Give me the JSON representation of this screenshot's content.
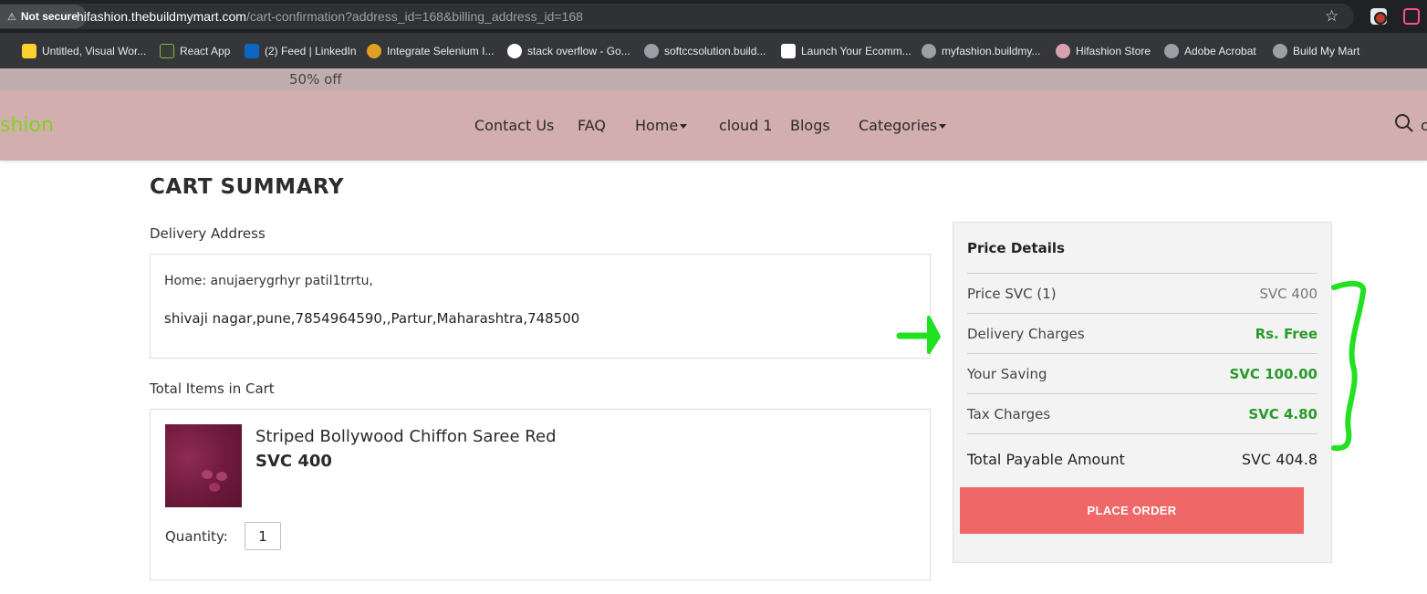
{
  "browser": {
    "security_label": "Not secure",
    "url_host": "hifashion.thebuildmymart.com",
    "url_path": "/cart-confirmation?address_id=168&billing_address_id=168",
    "bookmarks": [
      {
        "label": "Untitled, Visual Wor...",
        "icon": "miro-icon",
        "color": "#ffd02f"
      },
      {
        "label": "React App",
        "icon": "react-icon",
        "color": "#3a3a3a"
      },
      {
        "label": "(2) Feed | LinkedIn",
        "icon": "linkedin-icon",
        "color": "#0a66c2"
      },
      {
        "label": "Integrate Selenium I...",
        "icon": "chrome-icon",
        "color": "#e0a020"
      },
      {
        "label": "stack overflow - Go...",
        "icon": "google-icon",
        "color": "#ffffff"
      },
      {
        "label": "softccsolution.build...",
        "icon": "globe-icon",
        "color": "#9aa0a6"
      },
      {
        "label": "Launch Your Ecomm...",
        "icon": "store-icon",
        "color": "#ffffff"
      },
      {
        "label": "myfashion.buildmy...",
        "icon": "globe-icon",
        "color": "#9aa0a6"
      },
      {
        "label": "Hifashion Store",
        "icon": "hifashion-icon",
        "color": "#d9a0b0"
      },
      {
        "label": "Adobe Acrobat",
        "icon": "globe-icon",
        "color": "#9aa0a6"
      },
      {
        "label": "Build My Mart",
        "icon": "globe-icon",
        "color": "#9aa0a6"
      }
    ]
  },
  "site": {
    "promo_text": "50% off",
    "brand_text": "shion",
    "nav": {
      "contact": "Contact Us",
      "faq": "FAQ",
      "home": "Home",
      "cloud": "cloud 1",
      "blogs": "Blogs",
      "categories": "Categories",
      "search_trail": "c"
    }
  },
  "cart": {
    "title": "CART SUMMARY",
    "delivery_label": "Delivery Address",
    "address_line1": "Home: anujaerygrhyr patil1trrtu,",
    "address_line2": "shivaji nagar,pune,7854964590,,Partur,Maharashtra,748500",
    "items_label": "Total Items in Cart",
    "product": {
      "name": "Striped Bollywood Chiffon Saree Red",
      "price": "SVC 400",
      "quantity_label": "Quantity:",
      "quantity": "1"
    }
  },
  "price_details": {
    "title": "Price Details",
    "rows": [
      {
        "label": "Price SVC  (1)",
        "value": "SVC  400",
        "green": false
      },
      {
        "label": "Delivery Charges",
        "value": "Rs. Free",
        "green": true
      },
      {
        "label": "Your Saving",
        "value": "SVC  100.00",
        "green": true
      },
      {
        "label": "Tax Charges",
        "value": "SVC  4.80",
        "green": true
      }
    ],
    "total_label": "Total Payable Amount",
    "total_value": "SVC  404.8",
    "place_order": "PLACE ORDER"
  },
  "colors": {
    "navbar": "#d3aeae",
    "promo": "#c2adae",
    "brand": "#7ed321",
    "place_order": "#f06767",
    "saving_green": "#2a9a2a",
    "annotation": "#22e022"
  }
}
